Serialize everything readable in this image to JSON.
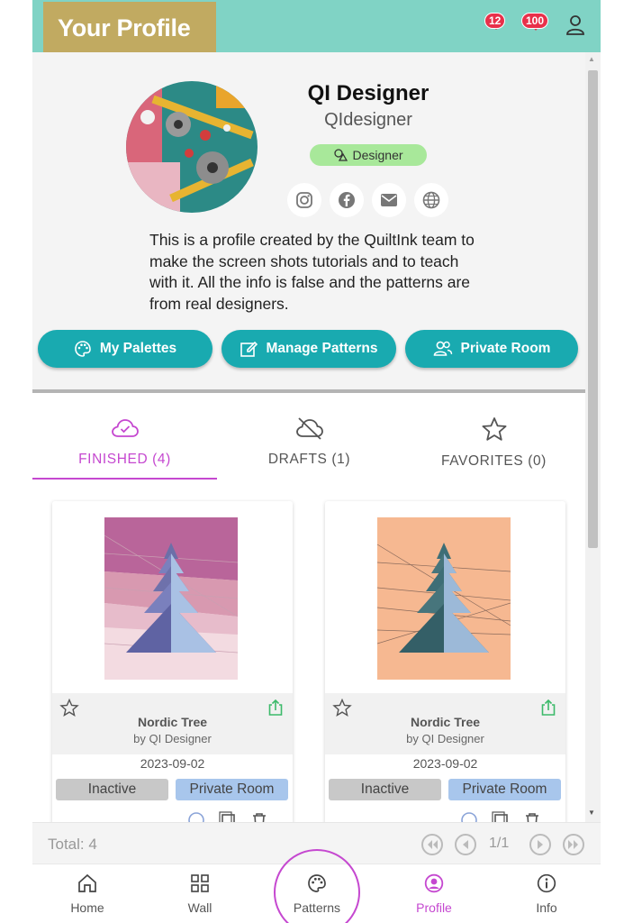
{
  "header": {
    "title": "Your Profile",
    "notifications_count": "12",
    "messages_count": "100"
  },
  "profile": {
    "name": "QI Designer",
    "handle": "QIdesigner",
    "role": "Designer",
    "bio": "This is a profile created by the QuiltInk team to make the screen shots tutorials and to teach with it. All the info is false and the patterns are from real designers.",
    "social": [
      "instagram-icon",
      "facebook-icon",
      "mail-icon",
      "globe-icon"
    ]
  },
  "actions": {
    "palettes": "My Palettes",
    "manage": "Manage Patterns",
    "private": "Private Room"
  },
  "tabs": [
    {
      "label": "FINISHED (4)",
      "icon": "cloud-check-icon",
      "active": true
    },
    {
      "label": "DRAFTS (1)",
      "icon": "cloud-off-icon",
      "active": false
    },
    {
      "label": "FAVORITES (0)",
      "icon": "star-icon",
      "active": false
    }
  ],
  "cards": [
    {
      "title": "Nordic Tree",
      "author": "by QI Designer",
      "date": "2023-09-02",
      "status": "Inactive",
      "room": "Private Room",
      "palette": "pink"
    },
    {
      "title": "Nordic Tree",
      "author": "by QI Designer",
      "date": "2023-09-02",
      "status": "Inactive",
      "room": "Private Room",
      "palette": "peach"
    }
  ],
  "footer": {
    "total": "Total: 4",
    "page": "1/1"
  },
  "nav": [
    {
      "label": "Home",
      "icon": "home-icon"
    },
    {
      "label": "Wall",
      "icon": "grid-icon"
    },
    {
      "label": "Patterns",
      "icon": "palette-icon"
    },
    {
      "label": "Profile",
      "icon": "user-circle-icon",
      "active": true
    },
    {
      "label": "Info",
      "icon": "info-icon"
    }
  ],
  "colors": {
    "header": "#80d3c5",
    "accent": "#c548d0",
    "button": "#19aab0",
    "badge": "#a8e89a"
  }
}
